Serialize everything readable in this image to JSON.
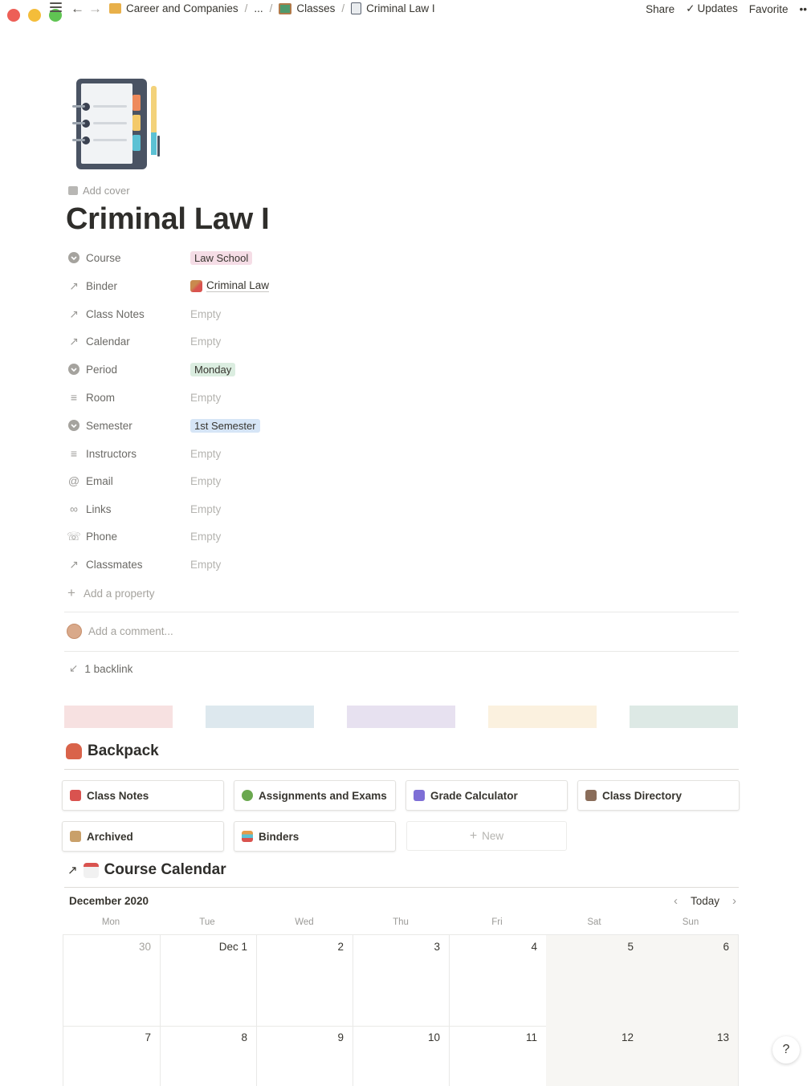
{
  "topbar": {
    "breadcrumbs": [
      "Career and Companies",
      "...",
      "Classes",
      "Criminal Law I"
    ],
    "share": "Share",
    "updates": "Updates",
    "favorite": "Favorite",
    "more": "••"
  },
  "page": {
    "add_cover": "Add cover",
    "title": "Criminal Law I"
  },
  "properties": [
    {
      "name": "Course",
      "icon": "select-icon",
      "value": "Law School",
      "kind": "tag",
      "color": "#f5dde6"
    },
    {
      "name": "Binder",
      "icon": "relation-arrow-icon",
      "value": "Criminal Law",
      "kind": "relation"
    },
    {
      "name": "Class Notes",
      "icon": "relation-arrow-icon",
      "value": "Empty",
      "kind": "empty"
    },
    {
      "name": "Calendar",
      "icon": "relation-arrow-icon",
      "value": "Empty",
      "kind": "empty"
    },
    {
      "name": "Period",
      "icon": "select-icon",
      "value": "Monday",
      "kind": "tag",
      "color": "#dbede0"
    },
    {
      "name": "Room",
      "icon": "text-icon",
      "value": "Empty",
      "kind": "empty"
    },
    {
      "name": "Semester",
      "icon": "select-icon",
      "value": "1st Semester",
      "kind": "tag",
      "color": "#d6e5f6"
    },
    {
      "name": "Instructors",
      "icon": "text-icon",
      "value": "Empty",
      "kind": "empty"
    },
    {
      "name": "Email",
      "icon": "at-icon",
      "value": "Empty",
      "kind": "empty"
    },
    {
      "name": "Links",
      "icon": "link-icon",
      "value": "Empty",
      "kind": "empty"
    },
    {
      "name": "Phone",
      "icon": "phone-icon",
      "value": "Empty",
      "kind": "empty"
    },
    {
      "name": "Classmates",
      "icon": "relation-arrow-icon",
      "value": "Empty",
      "kind": "empty"
    }
  ],
  "add_property": "Add a property",
  "comment_placeholder": "Add a comment...",
  "backlink": "1 backlink",
  "swatches": [
    "#f7e1e1",
    "#dde8ee",
    "#e7e1f0",
    "#fbf1df",
    "#dde9e5"
  ],
  "backpack": {
    "heading": "Backpack",
    "cards": [
      {
        "label": "Class Notes",
        "color": "#d9534f"
      },
      {
        "label": "Assignments and Exams",
        "color": "#6aa84f"
      },
      {
        "label": "Grade Calculator",
        "color": "#7e6fd6"
      },
      {
        "label": "Class Directory",
        "color": "#8a6d5a"
      },
      {
        "label": "Archived",
        "color": "#c9a06a"
      },
      {
        "label": "Binders",
        "color": "#e59b4a"
      }
    ],
    "new_label": "New"
  },
  "calendar": {
    "heading": "Course Calendar",
    "month": "December 2020",
    "today": "Today",
    "weekdays": [
      "Mon",
      "Tue",
      "Wed",
      "Thu",
      "Fri",
      "Sat",
      "Sun"
    ],
    "weeks": [
      [
        "30",
        "Dec 1",
        "2",
        "3",
        "4",
        "5",
        "6"
      ],
      [
        "7",
        "8",
        "9",
        "10",
        "11",
        "12",
        "13"
      ]
    ]
  },
  "help": "?"
}
